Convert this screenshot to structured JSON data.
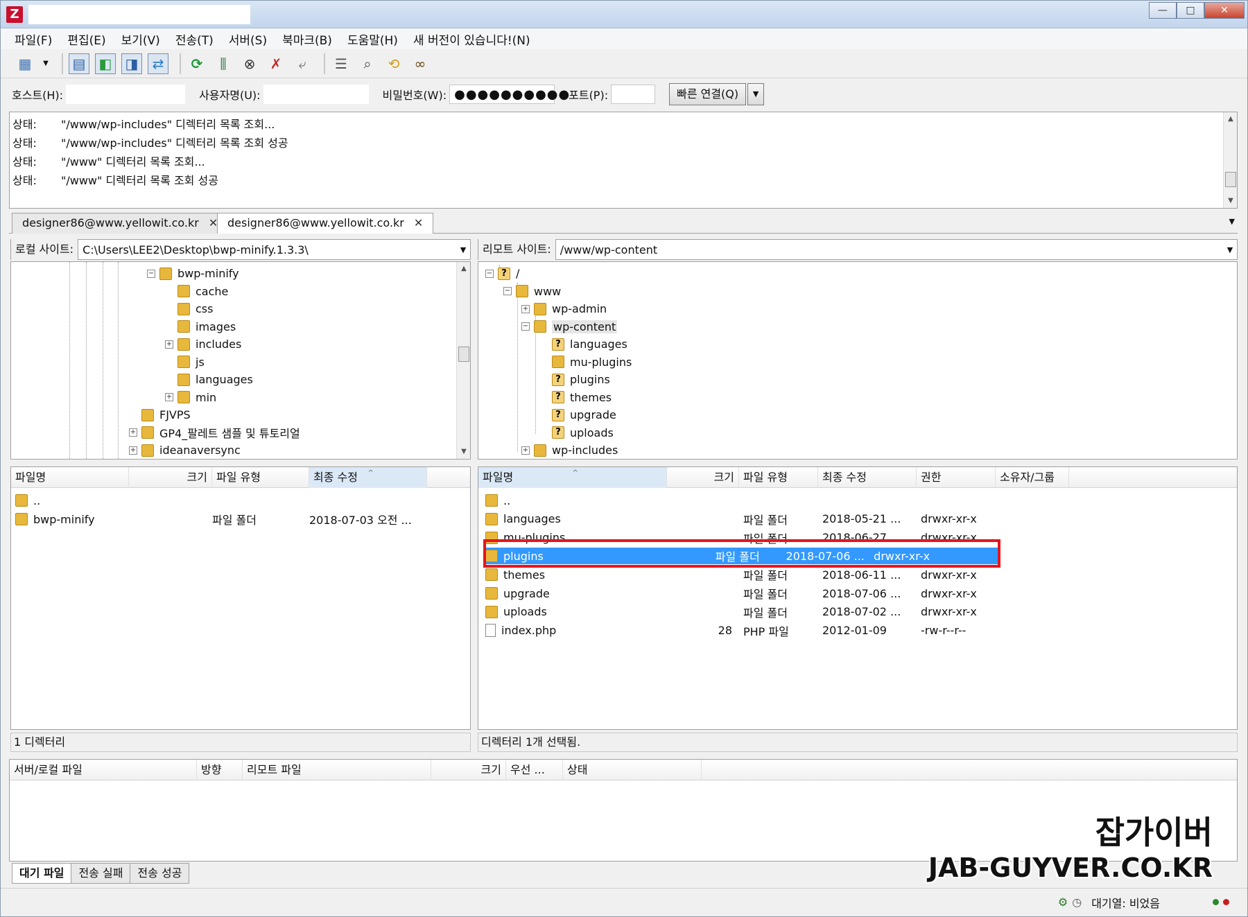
{
  "app": {
    "icon": "filezilla-icon",
    "title": ""
  },
  "window_buttons": {
    "minimize": "—",
    "maximize": "□",
    "close": "✕"
  },
  "menu": [
    "파일(F)",
    "편집(E)",
    "보기(V)",
    "전송(T)",
    "서버(S)",
    "북마크(B)",
    "도움말(H)",
    "새 버전이 있습니다!(N)"
  ],
  "toolbar": {
    "icons": [
      "site-manager-icon",
      "dropdown-arrow-icon",
      "toggle-log-icon",
      "toggle-local-tree-icon",
      "toggle-remote-tree-icon",
      "toggle-queue-icon",
      "refresh-icon",
      "process-queue-icon",
      "cancel-icon",
      "disconnect-icon",
      "reconnect-icon",
      "filter-icon",
      "compare-icon",
      "sync-browse-icon",
      "search-icon"
    ]
  },
  "quickconnect": {
    "host_label": "호스트(H):",
    "host_value": "",
    "user_label": "사용자명(U):",
    "user_value": "",
    "pass_label": "비밀번호(W):",
    "pass_value": "●●●●●●●●●●",
    "port_label": "포트(P):",
    "port_value": "",
    "button": "빠른 연결(Q)",
    "dropdown": "▼"
  },
  "log": [
    {
      "key": "상태:",
      "text": "\"/www/wp-includes\" 디렉터리 목록 조회..."
    },
    {
      "key": "상태:",
      "text": "\"/www/wp-includes\" 디렉터리 목록 조회 성공"
    },
    {
      "key": "상태:",
      "text": "\"/www\" 디렉터리 목록 조회..."
    },
    {
      "key": "상태:",
      "text": "\"/www\" 디렉터리 목록 조회 성공"
    }
  ],
  "tabs": [
    {
      "label": "designer86@www.yellowit.co.kr",
      "close": "✕"
    },
    {
      "label": "designer86@www.yellowit.co.kr",
      "close": "✕"
    }
  ],
  "local": {
    "path_label": "로컬 사이트:",
    "path": "C:\\Users\\LEE2\\Desktop\\bwp-minify.1.3.3\\",
    "tree": [
      {
        "label": "bwp-minify",
        "exp": "⊟",
        "q": false
      },
      {
        "label": "cache",
        "exp": "",
        "q": false
      },
      {
        "label": "css",
        "exp": "",
        "q": false
      },
      {
        "label": "images",
        "exp": "",
        "q": false
      },
      {
        "label": "includes",
        "exp": "⊞",
        "q": false
      },
      {
        "label": "js",
        "exp": "",
        "q": false
      },
      {
        "label": "languages",
        "exp": "",
        "q": false
      },
      {
        "label": "min",
        "exp": "⊞",
        "q": false
      },
      {
        "label": "FJVPS",
        "exp": "",
        "q": false
      },
      {
        "label": "GP4_팔레트 샘플 및 튜토리얼",
        "exp": "⊞",
        "q": false
      },
      {
        "label": "ideanaversync",
        "exp": "⊞",
        "q": false
      }
    ],
    "headers": [
      "파일명",
      "크기",
      "파일 유형",
      "최종 수정"
    ],
    "files": [
      {
        "name": "..",
        "size": "",
        "type": "",
        "modified": ""
      },
      {
        "name": "bwp-minify",
        "size": "",
        "type": "파일 폴더",
        "modified": "2018-07-03 오전 ..."
      }
    ],
    "status": "1 디렉터리"
  },
  "remote": {
    "path_label": "리모트 사이트:",
    "path": "/www/wp-content",
    "tree": [
      {
        "label": "/",
        "exp": "⊟",
        "q": true
      },
      {
        "label": "www",
        "exp": "⊟",
        "q": false
      },
      {
        "label": "wp-admin",
        "exp": "⊞",
        "q": false
      },
      {
        "label": "wp-content",
        "exp": "⊟",
        "q": false
      },
      {
        "label": "languages",
        "exp": "",
        "q": true
      },
      {
        "label": "mu-plugins",
        "exp": "",
        "q": false
      },
      {
        "label": "plugins",
        "exp": "",
        "q": true
      },
      {
        "label": "themes",
        "exp": "",
        "q": true
      },
      {
        "label": "upgrade",
        "exp": "",
        "q": true
      },
      {
        "label": "uploads",
        "exp": "",
        "q": true
      },
      {
        "label": "wp-includes",
        "exp": "⊞",
        "q": false
      }
    ],
    "headers": [
      "파일명",
      "크기",
      "파일 유형",
      "최종 수정",
      "권한",
      "소유자/그룹"
    ],
    "files": [
      {
        "name": "..",
        "size": "",
        "type": "",
        "modified": "",
        "perm": "",
        "owner": "",
        "folder": true
      },
      {
        "name": "languages",
        "size": "",
        "type": "파일 폴더",
        "modified": "2018-05-21 ...",
        "perm": "drwxr-xr-x",
        "owner": "",
        "folder": true
      },
      {
        "name": "mu-plugins",
        "size": "",
        "type": "파일 폴더",
        "modified": "2018-06-27 ...",
        "perm": "drwxr-xr-x",
        "owner": "",
        "folder": true
      },
      {
        "name": "plugins",
        "size": "",
        "type": "파일 폴더",
        "modified": "2018-07-06 ...",
        "perm": "drwxr-xr-x",
        "owner": "",
        "folder": true,
        "selected": true
      },
      {
        "name": "themes",
        "size": "",
        "type": "파일 폴더",
        "modified": "2018-06-11 ...",
        "perm": "drwxr-xr-x",
        "owner": "",
        "folder": true
      },
      {
        "name": "upgrade",
        "size": "",
        "type": "파일 폴더",
        "modified": "2018-07-06 ...",
        "perm": "drwxr-xr-x",
        "owner": "",
        "folder": true
      },
      {
        "name": "uploads",
        "size": "",
        "type": "파일 폴더",
        "modified": "2018-07-02 ...",
        "perm": "drwxr-xr-x",
        "owner": "",
        "folder": true
      },
      {
        "name": "index.php",
        "size": "28",
        "type": "PHP 파일",
        "modified": "2012-01-09",
        "perm": "-rw-r--r--",
        "owner": "",
        "folder": false
      }
    ],
    "status": "디렉터리 1개 선택됨."
  },
  "queue": {
    "headers": [
      "서버/로컬 파일",
      "방향",
      "리모트 파일",
      "크기",
      "우선 ...",
      "상태"
    ],
    "tabs": [
      "대기 파일",
      "전송 실패",
      "전송 성공"
    ]
  },
  "statusbar": {
    "queue_text": "대기열: 비었음",
    "icons": [
      "settings-icon",
      "speed-limit-icon"
    ],
    "colors": {
      "left_led": "#2a8a2a",
      "right_led": "#c81e1e"
    }
  },
  "watermark": {
    "line1": "잡가이버",
    "line2": "JAB-GUYVER.CO.KR"
  },
  "colors": {
    "selection": "#3399ff",
    "highlight_box": "#e8141c"
  }
}
